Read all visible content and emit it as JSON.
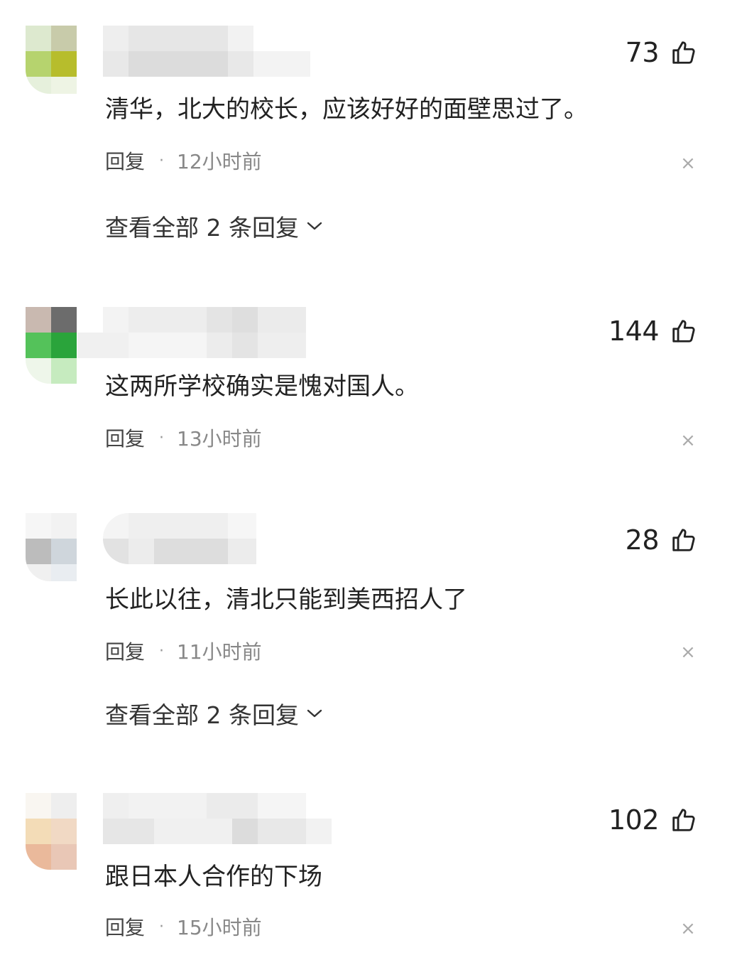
{
  "comments": [
    {
      "likes": "73",
      "text": "清华，北大的校长，应该好好的面壁思过了。",
      "reply_label": "回复",
      "separator": "·",
      "time": "12小时前",
      "view_all": "查看全部 2 条回复"
    },
    {
      "likes": "144",
      "text": "这两所学校确实是愧对国人。",
      "reply_label": "回复",
      "separator": "·",
      "time": "13小时前"
    },
    {
      "likes": "28",
      "text": "长此以往，清北只能到美西招人了",
      "reply_label": "回复",
      "separator": "·",
      "time": "11小时前",
      "view_all": "查看全部 2 条回复"
    },
    {
      "likes": "102",
      "text": "跟日本人合作的下场",
      "reply_label": "回复",
      "separator": "·",
      "time": "15小时前"
    }
  ],
  "icons": {
    "like": "thumbs-up-icon",
    "close": "close-icon",
    "expand": "chevron-down-icon"
  },
  "colors": {
    "text": "#222222",
    "meta": "#888888",
    "close": "#aaaaaa"
  }
}
